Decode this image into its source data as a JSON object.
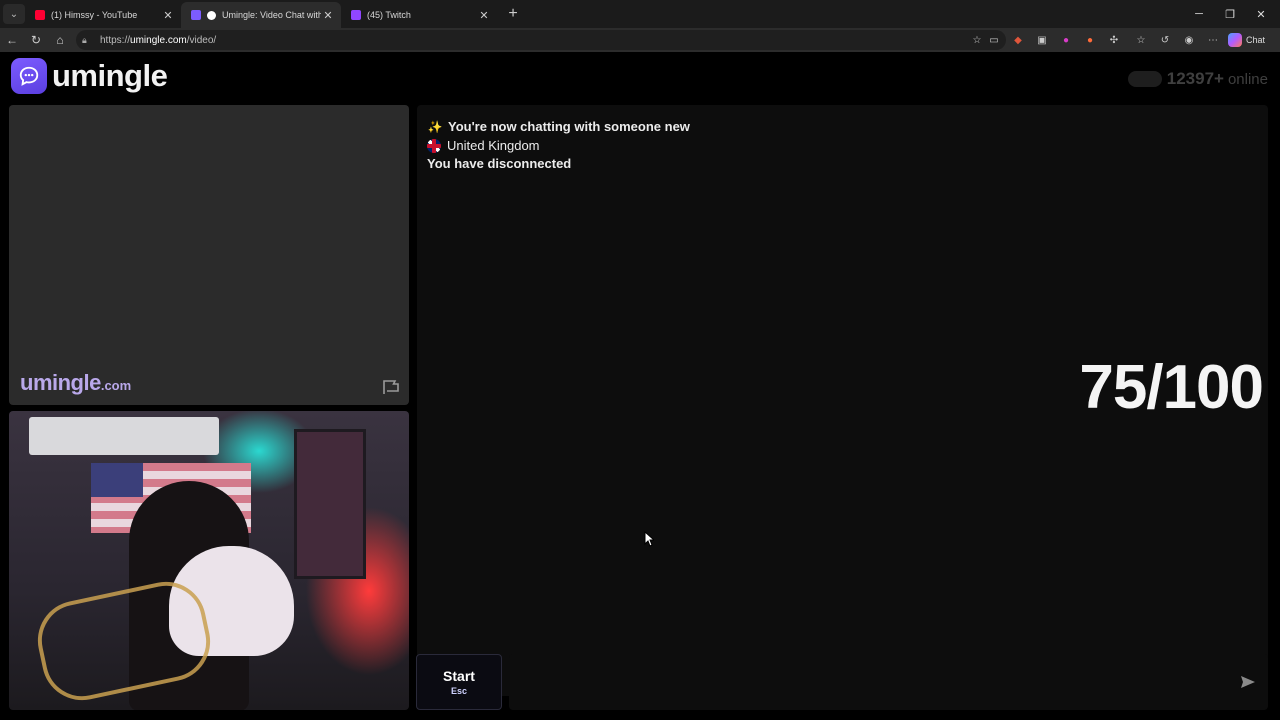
{
  "browser": {
    "tabs": [
      {
        "title": "(1) Himssy - YouTube",
        "favicon": "youtube-icon",
        "color": "#ff0033",
        "active": false
      },
      {
        "title": "Umingle: Video Chat with Stra",
        "favicon": "umingle-icon",
        "color": "#7c5cff",
        "active": true
      },
      {
        "title": "(45) Twitch",
        "favicon": "twitch-icon",
        "color": "#9146ff",
        "active": false
      }
    ],
    "url_prefix": "https://",
    "url_host": "umingle.com",
    "url_path": "/video/",
    "chat_label": "Chat"
  },
  "site": {
    "logo_text": "umingle",
    "online_count": "12397+",
    "online_suffix": "online",
    "watermark_main": "umingle",
    "watermark_domain": ".com"
  },
  "chat": {
    "messages": [
      {
        "emoji": "✨",
        "text": "You're now chatting with someone new"
      },
      {
        "emoji": "uk-flag",
        "text": "United Kingdom"
      },
      {
        "emoji": "",
        "text": "You have disconnected"
      }
    ],
    "score": "75/100"
  },
  "controls": {
    "start_label": "Start",
    "start_key": "Esc",
    "input_value": "",
    "input_placeholder": ""
  },
  "colors": {
    "brand": "#7c5cff",
    "watermark": "#b9a8ea",
    "panel": "#0d0d0d"
  }
}
